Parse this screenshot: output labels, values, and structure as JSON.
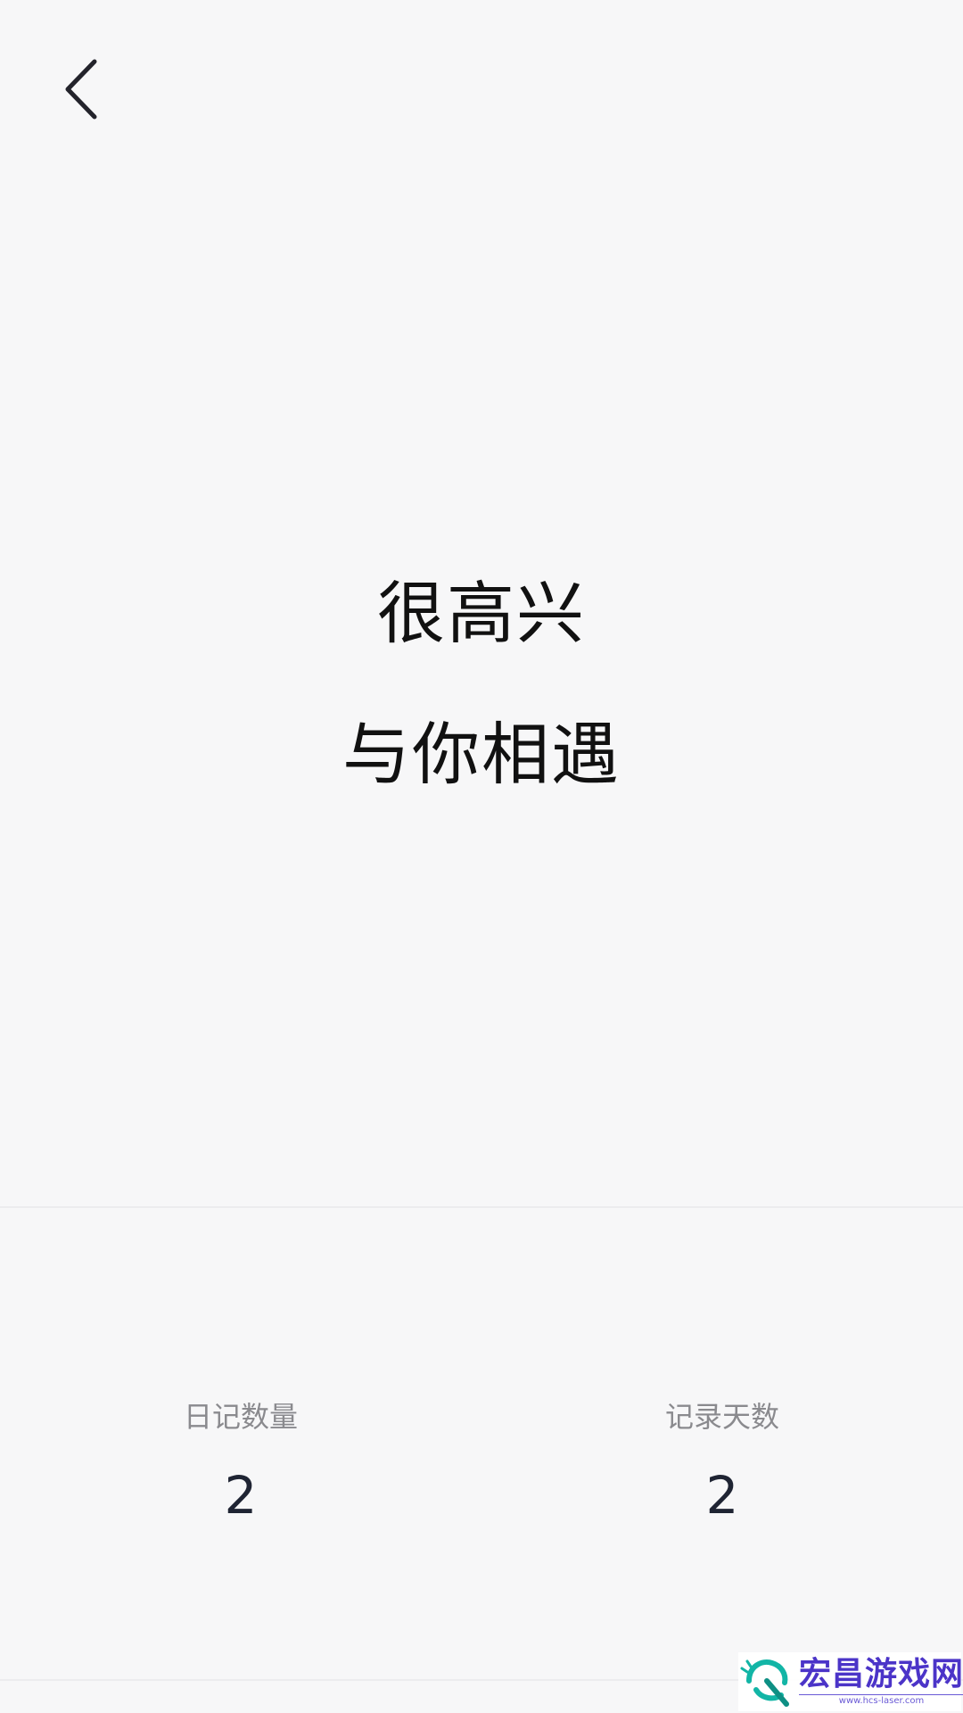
{
  "nav": {
    "back_icon": "chevron-left-icon"
  },
  "greeting": {
    "line1": "很高兴",
    "line2": "与你相遇"
  },
  "stats": [
    {
      "label": "日记数量",
      "value": "2"
    },
    {
      "label": "记录天数",
      "value": "2"
    }
  ],
  "watermark": {
    "title": "宏昌游戏网",
    "url": "www.hcs-laser.com",
    "logo_color": "#12b5a6",
    "title_color": "#4b34c8"
  },
  "colors": {
    "background": "#f7f7f8",
    "greeting_text": "#111111",
    "stat_label": "#8a8a8e",
    "stat_value": "#1f2433"
  }
}
